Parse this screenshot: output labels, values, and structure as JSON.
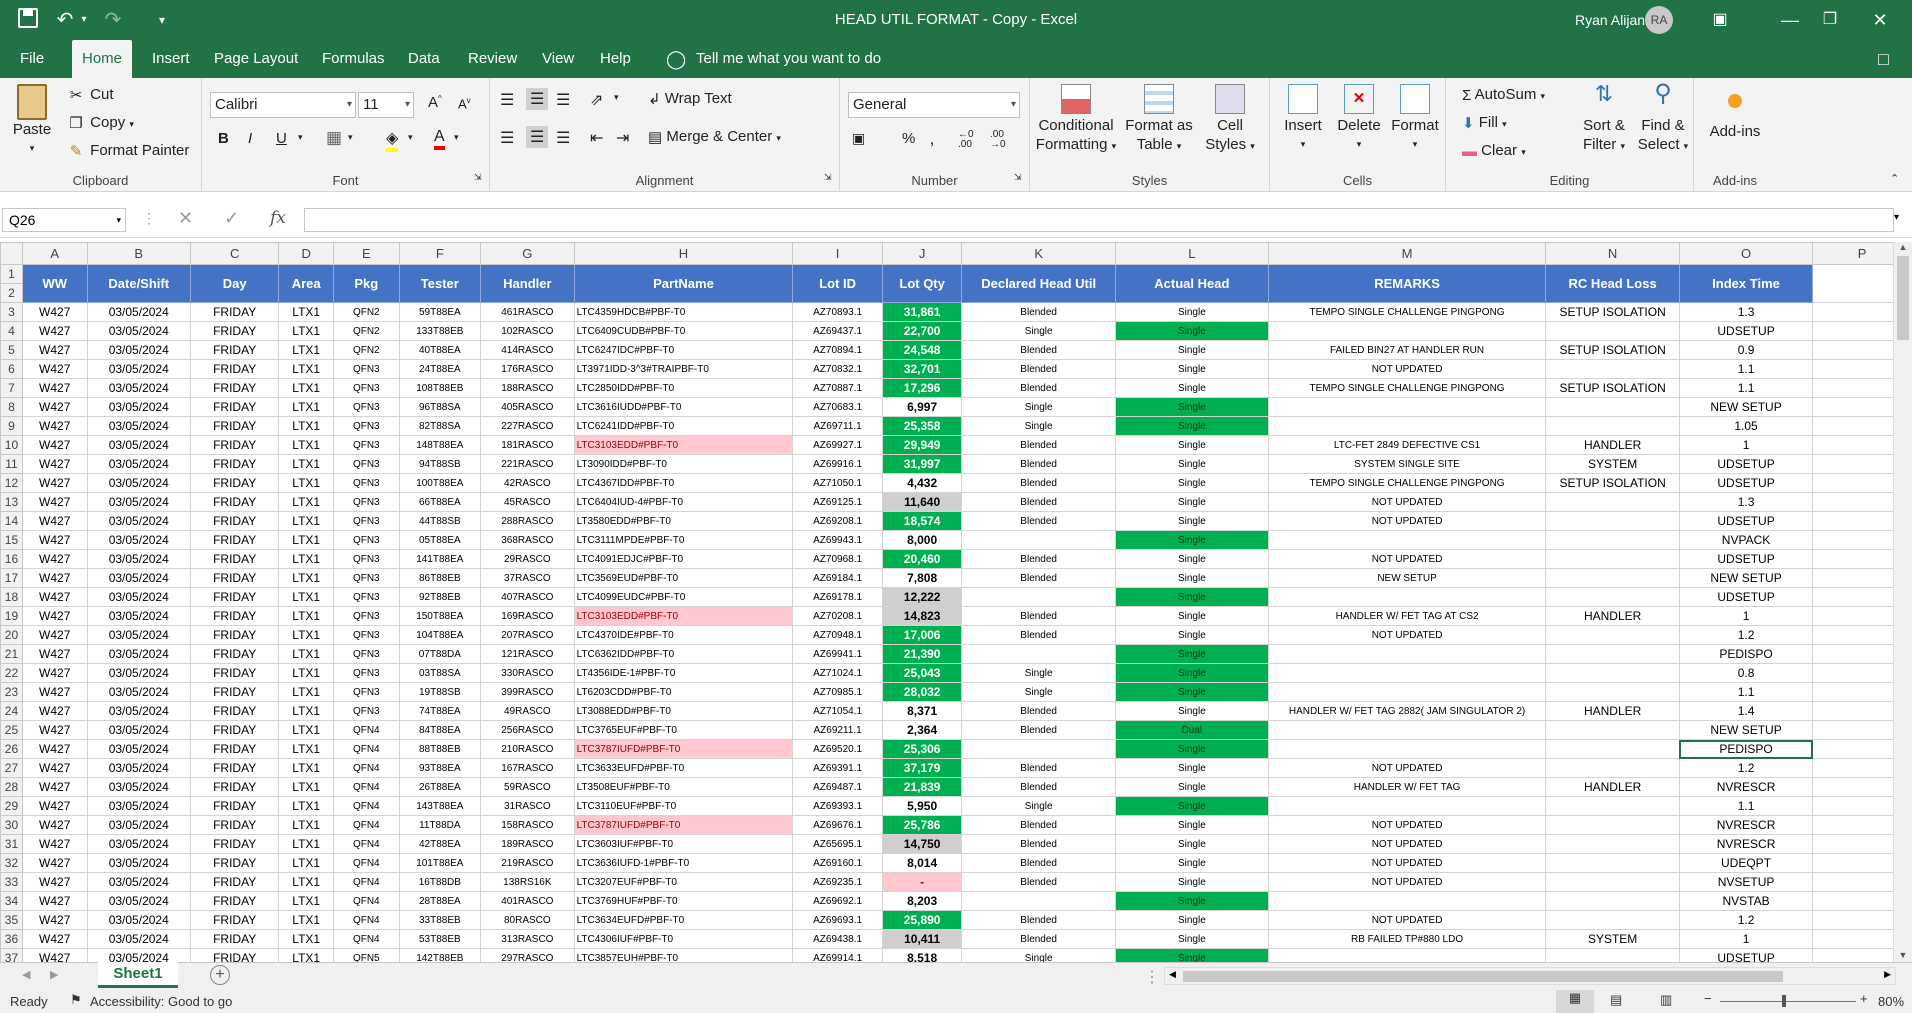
{
  "quick_access": {
    "save": "save-icon",
    "undo": "undo-icon",
    "redo": "redo-icon",
    "customize": "customize-icon"
  },
  "title": "HEAD UTIL FORMAT - Copy  -  Excel",
  "user": {
    "name": "Ryan Alijan",
    "initials": "RA"
  },
  "tabs": [
    "File",
    "Home",
    "Insert",
    "Page Layout",
    "Formulas",
    "Data",
    "Review",
    "View",
    "Help"
  ],
  "tell_me": "Tell me what you want to do",
  "ribbon": {
    "clipboard": {
      "label": "Clipboard",
      "paste": "Paste",
      "cut": "Cut",
      "copy": "Copy",
      "format_painter": "Format Painter"
    },
    "font": {
      "label": "Font",
      "name": "Calibri",
      "size": "11",
      "bold": "B",
      "italic": "I",
      "underline": "U"
    },
    "alignment": {
      "label": "Alignment",
      "wrap": "Wrap Text",
      "merge": "Merge & Center"
    },
    "number": {
      "label": "Number",
      "format": "General"
    },
    "styles": {
      "label": "Styles",
      "conditional": "Conditional",
      "conditional2": "Formatting",
      "format_as": "Format as",
      "format_as2": "Table",
      "cell": "Cell",
      "cell2": "Styles"
    },
    "cells": {
      "label": "Cells",
      "insert": "Insert",
      "delete": "Delete",
      "format": "Format"
    },
    "editing": {
      "label": "Editing",
      "autosum": "AutoSum",
      "fill": "Fill",
      "clear": "Clear",
      "sort": "Sort &",
      "sort2": "Filter",
      "find": "Find &",
      "find2": "Select"
    },
    "addins": {
      "label": "Add-ins",
      "addins": "Add-ins"
    }
  },
  "name_box": "Q26",
  "formula": "",
  "columns": [
    "A",
    "B",
    "C",
    "D",
    "E",
    "F",
    "G",
    "H",
    "I",
    "J",
    "K",
    "L",
    "M",
    "N",
    "O",
    "P"
  ],
  "headers": [
    "WW",
    "Date/Shift",
    "Day",
    "Area",
    "Pkg",
    "Tester",
    "Handler",
    "PartName",
    "Lot ID",
    "Lot Qty",
    "Declared Head Util",
    "Actual Head",
    "REMARKS",
    "RC Head Loss",
    "Index Time"
  ],
  "rows": [
    [
      "3",
      "W427",
      "03/05/2024",
      "FRIDAY",
      "LTX1",
      "QFN2",
      "59T88EA",
      "461RASCO",
      "LTC4359HDCB#PBF-T0",
      "AZ70893.1",
      "31,861",
      "Blended",
      "Single",
      "TEMPO SINGLE  CHALLENGE PINGPONG",
      "SETUP ISOLATION",
      "1.3"
    ],
    [
      "4",
      "W427",
      "03/05/2024",
      "FRIDAY",
      "LTX1",
      "QFN2",
      "133T88EB",
      "102RASCO",
      "LTC6409CUDB#PBF-T0",
      "AZ69437.1",
      "22,700",
      "Single",
      "Single",
      "",
      "",
      "UDSETUP"
    ],
    [
      "5",
      "W427",
      "03/05/2024",
      "FRIDAY",
      "LTX1",
      "QFN2",
      "40T88EA",
      "414RASCO",
      "LTC6247IDC#PBF-T0",
      "AZ70894.1",
      "24,548",
      "Blended",
      "Single",
      "FAILED BIN27 AT HANDLER RUN",
      "SETUP ISOLATION",
      "0.9"
    ],
    [
      "6",
      "W427",
      "03/05/2024",
      "FRIDAY",
      "LTX1",
      "QFN3",
      "24T88EA",
      "176RASCO",
      "LT3971IDD-3^3#TRAIPBF-T0",
      "AZ70832.1",
      "32,701",
      "Blended",
      "Single",
      "NOT UPDATED",
      "",
      "1.1"
    ],
    [
      "7",
      "W427",
      "03/05/2024",
      "FRIDAY",
      "LTX1",
      "QFN3",
      "108T88EB",
      "188RASCO",
      "LTC2850IDD#PBF-T0",
      "AZ70887.1",
      "17,296",
      "Blended",
      "Single",
      "TEMPO SINGLE  CHALLENGE PINGPONG",
      "SETUP ISOLATION",
      "1.1"
    ],
    [
      "8",
      "W427",
      "03/05/2024",
      "FRIDAY",
      "LTX1",
      "QFN3",
      "96T88SA",
      "405RASCO",
      "LTC3616IUDD#PBF-T0",
      "AZ70683.1",
      "6,997",
      "Single",
      "Single",
      "",
      "",
      "NEW SETUP"
    ],
    [
      "9",
      "W427",
      "03/05/2024",
      "FRIDAY",
      "LTX1",
      "QFN3",
      "82T88SA",
      "227RASCO",
      "LTC6241IDD#PBF-T0",
      "AZ69711.1",
      "25,358",
      "Single",
      "Single",
      "",
      "",
      "1.05"
    ],
    [
      "10",
      "W427",
      "03/05/2024",
      "FRIDAY",
      "LTX1",
      "QFN3",
      "148T88EA",
      "181RASCO",
      "LTC3103EDD#PBF-T0",
      "AZ69927.1",
      "29,949",
      "Blended",
      "Single",
      "LTC-FET 2849 DEFECTIVE CS1",
      "HANDLER",
      "1"
    ],
    [
      "11",
      "W427",
      "03/05/2024",
      "FRIDAY",
      "LTX1",
      "QFN3",
      "94T88SB",
      "221RASCO",
      "LT3090IDD#PBF-T0",
      "AZ69916.1",
      "31,997",
      "Blended",
      "Single",
      "SYSTEM SINGLE SITE",
      "SYSTEM",
      "UDSETUP"
    ],
    [
      "12",
      "W427",
      "03/05/2024",
      "FRIDAY",
      "LTX1",
      "QFN3",
      "100T88EA",
      "42RASCO",
      "LTC4367IDD#PBF-T0",
      "AZ71050.1",
      "4,432",
      "Blended",
      "Single",
      "TEMPO SINGLE  CHALLENGE PINGPONG",
      "SETUP ISOLATION",
      "UDSETUP"
    ],
    [
      "13",
      "W427",
      "03/05/2024",
      "FRIDAY",
      "LTX1",
      "QFN3",
      "66T88EA",
      "45RASCO",
      "LTC6404IUD-4#PBF-T0",
      "AZ69125.1",
      "11,640",
      "Blended",
      "Single",
      "NOT UPDATED",
      "",
      "1.3"
    ],
    [
      "14",
      "W427",
      "03/05/2024",
      "FRIDAY",
      "LTX1",
      "QFN3",
      "44T88SB",
      "288RASCO",
      "LT3580EDD#PBF-T0",
      "AZ69208.1",
      "18,574",
      "Blended",
      "Single",
      "NOT UPDATED",
      "",
      "UDSETUP"
    ],
    [
      "15",
      "W427",
      "03/05/2024",
      "FRIDAY",
      "LTX1",
      "QFN3",
      "05T88EA",
      "368RASCO",
      "LTC3111MPDE#PBF-T0",
      "AZ69943.1",
      "8,000",
      "",
      "Single",
      "",
      "",
      "NVPACK"
    ],
    [
      "16",
      "W427",
      "03/05/2024",
      "FRIDAY",
      "LTX1",
      "QFN3",
      "141T88EA",
      "29RASCO",
      "LTC4091EDJC#PBF-T0",
      "AZ70968.1",
      "20,460",
      "Blended",
      "Single",
      "NOT UPDATED",
      "",
      "UDSETUP"
    ],
    [
      "17",
      "W427",
      "03/05/2024",
      "FRIDAY",
      "LTX1",
      "QFN3",
      "86T88EB",
      "37RASCO",
      "LTC3569EUD#PBF-T0",
      "AZ69184.1",
      "7,808",
      "Blended",
      "Single",
      "NEW SETUP",
      "",
      "NEW SETUP"
    ],
    [
      "18",
      "W427",
      "03/05/2024",
      "FRIDAY",
      "LTX1",
      "QFN3",
      "92T88EB",
      "407RASCO",
      "LTC4099EUDC#PBF-T0",
      "AZ69178.1",
      "12,222",
      "",
      "Single",
      "",
      "",
      "UDSETUP"
    ],
    [
      "19",
      "W427",
      "03/05/2024",
      "FRIDAY",
      "LTX1",
      "QFN3",
      "150T88EA",
      "169RASCO",
      "LTC3103EDD#PBF-T0",
      "AZ70208.1",
      "14,823",
      "Blended",
      "Single",
      "HANDLER W/ FET TAG AT CS2",
      "HANDLER",
      "1"
    ],
    [
      "20",
      "W427",
      "03/05/2024",
      "FRIDAY",
      "LTX1",
      "QFN3",
      "104T88EA",
      "207RASCO",
      "LTC4370IDE#PBF-T0",
      "AZ70948.1",
      "17,006",
      "Blended",
      "Single",
      "NOT UPDATED",
      "",
      "1.2"
    ],
    [
      "21",
      "W427",
      "03/05/2024",
      "FRIDAY",
      "LTX1",
      "QFN3",
      "07T88DA",
      "121RASCO",
      "LTC6362IDD#PBF-T0",
      "AZ69941.1",
      "21,390",
      "",
      "Single",
      "",
      "",
      "PEDISPO"
    ],
    [
      "22",
      "W427",
      "03/05/2024",
      "FRIDAY",
      "LTX1",
      "QFN3",
      "03T88SA",
      "330RASCO",
      "LT4356IDE-1#PBF-T0",
      "AZ71024.1",
      "25,043",
      "Single",
      "Single",
      "",
      "",
      "0.8"
    ],
    [
      "23",
      "W427",
      "03/05/2024",
      "FRIDAY",
      "LTX1",
      "QFN3",
      "19T88SB",
      "399RASCO",
      "LT6203CDD#PBF-T0",
      "AZ70985.1",
      "28,032",
      "Single",
      "Single",
      "",
      "",
      "1.1"
    ],
    [
      "24",
      "W427",
      "03/05/2024",
      "FRIDAY",
      "LTX1",
      "QFN3",
      "74T88EA",
      "49RASCO",
      "LT3088EDD#PBF-T0",
      "AZ71054.1",
      "8,371",
      "Blended",
      "Single",
      "HANDLER W/ FET TAG 2882( JAM SINGULATOR 2)",
      "HANDLER",
      "1.4"
    ],
    [
      "25",
      "W427",
      "03/05/2024",
      "FRIDAY",
      "LTX1",
      "QFN4",
      "84T88EA",
      "256RASCO",
      "LTC3765EUF#PBF-T0",
      "AZ69211.1",
      "2,364",
      "Blended",
      "Dual",
      "",
      "",
      "NEW SETUP"
    ],
    [
      "26",
      "W427",
      "03/05/2024",
      "FRIDAY",
      "LTX1",
      "QFN4",
      "88T88EB",
      "210RASCO",
      "LTC3787IUFD#PBF-T0",
      "AZ69520.1",
      "25,306",
      "",
      "Single",
      "",
      "",
      "PEDISPO"
    ],
    [
      "27",
      "W427",
      "03/05/2024",
      "FRIDAY",
      "LTX1",
      "QFN4",
      "93T88EA",
      "167RASCO",
      "LTC3633EUFD#PBF-T0",
      "AZ69391.1",
      "37,179",
      "Blended",
      "Single",
      "NOT UPDATED",
      "",
      "1.2"
    ],
    [
      "28",
      "W427",
      "03/05/2024",
      "FRIDAY",
      "LTX1",
      "QFN4",
      "26T88EA",
      "59RASCO",
      "LT3508EUF#PBF-T0",
      "AZ69487.1",
      "21,839",
      "Blended",
      "Single",
      "HANDLER W/ FET TAG",
      "HANDLER",
      "NVRESCR"
    ],
    [
      "29",
      "W427",
      "03/05/2024",
      "FRIDAY",
      "LTX1",
      "QFN4",
      "143T88EA",
      "31RASCO",
      "LTC3110EUF#PBF-T0",
      "AZ69393.1",
      "5,950",
      "Single",
      "Single",
      "",
      "",
      "1.1"
    ],
    [
      "30",
      "W427",
      "03/05/2024",
      "FRIDAY",
      "LTX1",
      "QFN4",
      "11T88DA",
      "158RASCO",
      "LTC3787IUFD#PBF-T0",
      "AZ69676.1",
      "25,786",
      "Blended",
      "Single",
      "NOT UPDATED",
      "",
      "NVRESCR"
    ],
    [
      "31",
      "W427",
      "03/05/2024",
      "FRIDAY",
      "LTX1",
      "QFN4",
      "42T88EA",
      "189RASCO",
      "LTC3603IUF#PBF-T0",
      "AZ65695.1",
      "14,750",
      "Blended",
      "Single",
      "NOT UPDATED",
      "",
      "NVRESCR"
    ],
    [
      "32",
      "W427",
      "03/05/2024",
      "FRIDAY",
      "LTX1",
      "QFN4",
      "101T88EA",
      "219RASCO",
      "LTC3636IUFD-1#PBF-T0",
      "AZ69160.1",
      "8,014",
      "Blended",
      "Single",
      "NOT UPDATED",
      "",
      "UDEQPT"
    ],
    [
      "33",
      "W427",
      "03/05/2024",
      "FRIDAY",
      "LTX1",
      "QFN4",
      "16T88DB",
      "138RS16K",
      "LTC3207EUF#PBF-T0",
      "AZ69235.1",
      "-",
      "Blended",
      "Single",
      "NOT UPDATED",
      "",
      "NVSETUP"
    ],
    [
      "34",
      "W427",
      "03/05/2024",
      "FRIDAY",
      "LTX1",
      "QFN4",
      "28T88EA",
      "401RASCO",
      "LTC3769HUF#PBF-T0",
      "AZ69692.1",
      "8,203",
      "",
      "Single",
      "",
      "",
      "NVSTAB"
    ],
    [
      "35",
      "W427",
      "03/05/2024",
      "FRIDAY",
      "LTX1",
      "QFN4",
      "33T88EB",
      "80RASCO",
      "LTC3634EUFD#PBF-T0",
      "AZ69693.1",
      "25,890",
      "Blended",
      "Single",
      "NOT UPDATED",
      "",
      "1.2"
    ],
    [
      "36",
      "W427",
      "03/05/2024",
      "FRIDAY",
      "LTX1",
      "QFN4",
      "53T88EB",
      "313RASCO",
      "LTC4306IUF#PBF-T0",
      "AZ69438.1",
      "10,411",
      "Blended",
      "Single",
      "RB FAILED TP#880 LDO",
      "SYSTEM",
      "1"
    ],
    [
      "37",
      "W427",
      "03/05/2024",
      "FRIDAY",
      "LTX1",
      "QFN5",
      "142T88EB",
      "297RASCO",
      "LTC3857EUH#PBF-T0",
      "AZ69914.1",
      "8,518",
      "Single",
      "Single",
      "",
      "",
      "UDSETUP"
    ]
  ],
  "sheet_tab": "Sheet1",
  "status": {
    "ready": "Ready",
    "accessibility": "Accessibility: Good to go",
    "zoom": "80%"
  }
}
